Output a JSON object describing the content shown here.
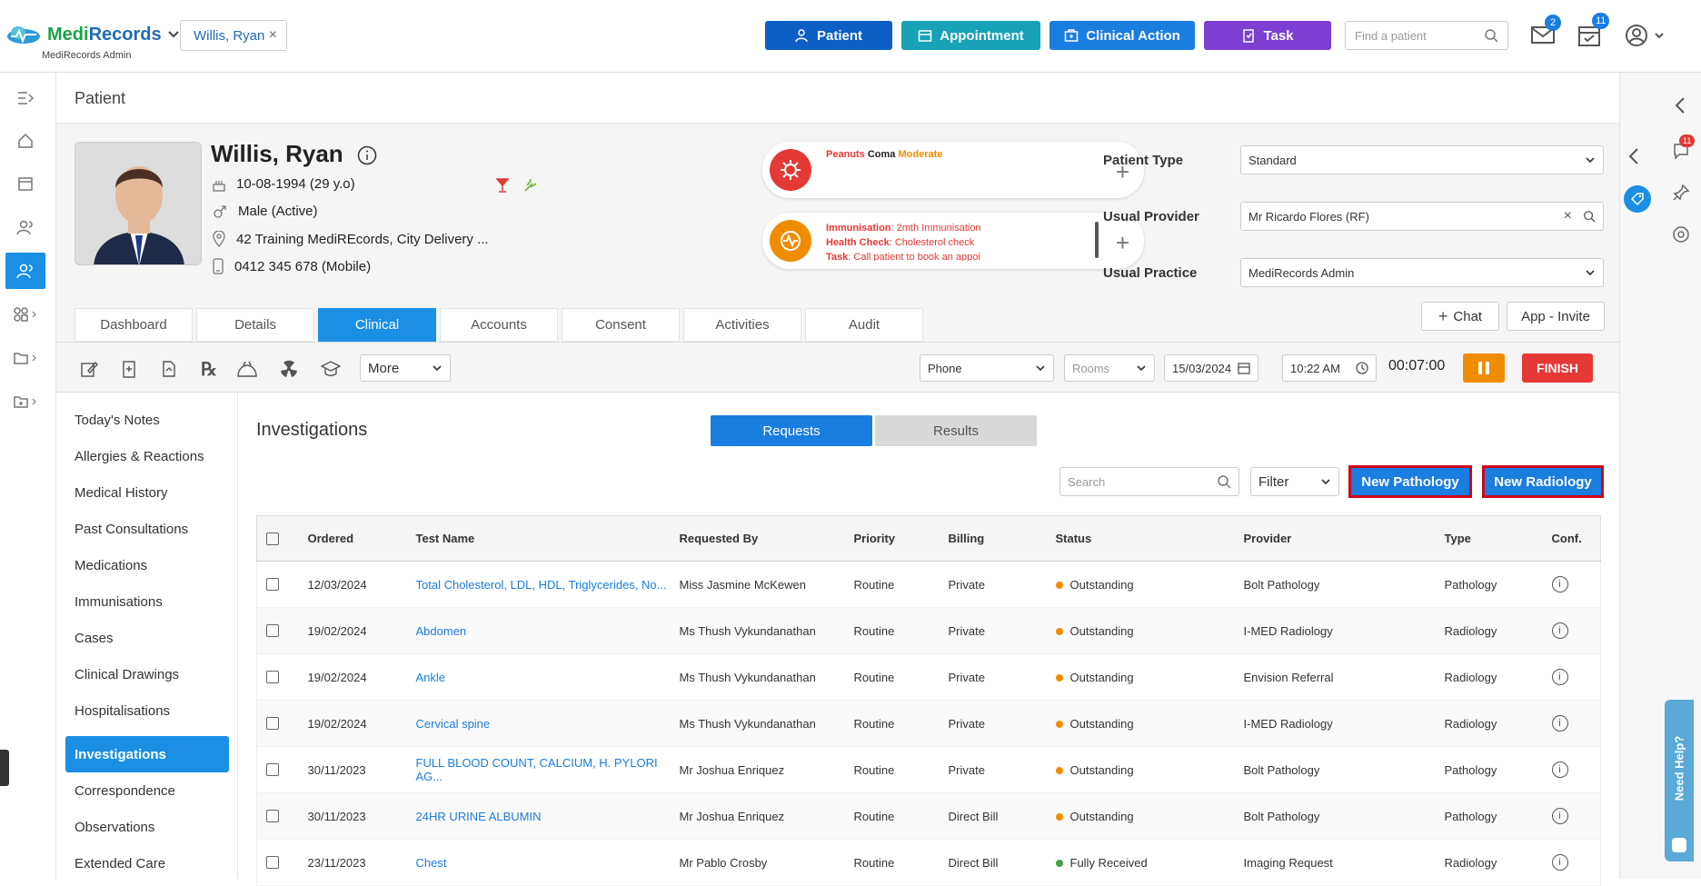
{
  "app": {
    "brand_part1": "Medi",
    "brand_part2": "Records",
    "subtitle": "MediRecords Admin",
    "patient_tag": "Willis, Ryan"
  },
  "topbar": {
    "buttons": [
      {
        "label": "Patient",
        "color": "#0b5fc5"
      },
      {
        "label": "Appointment",
        "color": "#17a2b8"
      },
      {
        "label": "Clinical Action",
        "color": "#1a7de0"
      },
      {
        "label": "Task",
        "color": "#7c3fd1"
      }
    ],
    "search_placeholder": "Find a patient",
    "mail_count": "2",
    "tasks_count": "11"
  },
  "page_title": "Patient",
  "patient": {
    "name": "Willis, Ryan",
    "dob": "10-08-1994 (29 y.o)",
    "gender": "Male (Active)",
    "address": "42 Training MediREcords, City Delivery ...",
    "phone": "0412 345 678 (Mobile)"
  },
  "allergy_card": {
    "allergen": "Peanuts",
    "reaction": "Coma",
    "severity": "Moderate"
  },
  "reminders_card": {
    "lines": [
      {
        "label": "Immunisation",
        "text": ": 2mth Immunisation"
      },
      {
        "label": "Health Check",
        "text": ": Cholesterol check"
      },
      {
        "label": "Task",
        "text": ": Call patient to book an appoi"
      }
    ]
  },
  "fields": {
    "patient_type_label": "Patient Type",
    "patient_type_value": "Standard",
    "usual_provider_label": "Usual Provider",
    "usual_provider_value": "Mr Ricardo Flores (RF)",
    "usual_practice_label": "Usual Practice",
    "usual_practice_value": "MediRecords Admin"
  },
  "tabs": [
    "Dashboard",
    "Details",
    "Clinical",
    "Accounts",
    "Consent",
    "Activities",
    "Audit"
  ],
  "chat_label": "Chat",
  "app_invite_label": "App - Invite",
  "toolbar": {
    "more_label": "More",
    "phone_value": "Phone",
    "rooms_placeholder": "Rooms",
    "date_value": "15/03/2024",
    "time_value": "10:22 AM",
    "timer": "00:07:00",
    "finish_label": "FINISH"
  },
  "sidenav": [
    "Today's Notes",
    "Allergies & Reactions",
    "Medical History",
    "Past Consultations",
    "Medications",
    "Immunisations",
    "Cases",
    "Clinical Drawings",
    "Hospitalisations",
    "Investigations",
    "Correspondence",
    "Observations",
    "Extended Care"
  ],
  "investigations": {
    "title": "Investigations",
    "requests_label": "Requests",
    "results_label": "Results",
    "search_placeholder": "Search",
    "filter_label": "Filter",
    "new_pathology_label": "New Pathology",
    "new_radiology_label": "New Radiology",
    "columns": [
      "Ordered",
      "Test Name",
      "Requested By",
      "Priority",
      "Billing",
      "Status",
      "Provider",
      "Type",
      "Conf."
    ],
    "rows": [
      {
        "ordered": "12/03/2024",
        "test": "Total Cholesterol, LDL, HDL, Triglycerides, No...",
        "by": "Miss Jasmine McKewen",
        "priority": "Routine",
        "billing": "Private",
        "status": "Outstanding",
        "status_color": "#f08c00",
        "provider": "Bolt Pathology",
        "type": "Pathology"
      },
      {
        "ordered": "19/02/2024",
        "test": "Abdomen",
        "by": "Ms Thush Vykundanathan",
        "priority": "Routine",
        "billing": "Private",
        "status": "Outstanding",
        "status_color": "#f08c00",
        "provider": "I-MED Radiology",
        "type": "Radiology"
      },
      {
        "ordered": "19/02/2024",
        "test": "Ankle",
        "by": "Ms Thush Vykundanathan",
        "priority": "Routine",
        "billing": "Private",
        "status": "Outstanding",
        "status_color": "#f08c00",
        "provider": "Envision Referral",
        "type": "Radiology"
      },
      {
        "ordered": "19/02/2024",
        "test": "Cervical spine",
        "by": "Ms Thush Vykundanathan",
        "priority": "Routine",
        "billing": "Private",
        "status": "Outstanding",
        "status_color": "#f08c00",
        "provider": "I-MED Radiology",
        "type": "Radiology"
      },
      {
        "ordered": "30/11/2023",
        "test": "FULL BLOOD COUNT, CALCIUM, H. PYLORI AG...",
        "by": "Mr Joshua Enriquez",
        "priority": "Routine",
        "billing": "Private",
        "status": "Outstanding",
        "status_color": "#f08c00",
        "provider": "Bolt Pathology",
        "type": "Pathology"
      },
      {
        "ordered": "30/11/2023",
        "test": "24HR URINE ALBUMIN",
        "by": "Mr Joshua Enriquez",
        "priority": "Routine",
        "billing": "Direct Bill",
        "status": "Outstanding",
        "status_color": "#f08c00",
        "provider": "Bolt Pathology",
        "type": "Pathology"
      },
      {
        "ordered": "23/11/2023",
        "test": "Chest",
        "by": "Mr Pablo Crosby",
        "priority": "Routine",
        "billing": "Direct Bill",
        "status": "Fully Received",
        "status_color": "#43a047",
        "provider": "Imaging Request",
        "type": "Radiology"
      }
    ]
  },
  "need_help_label": "Need Help?",
  "right_rail": {
    "chat_count": "11"
  }
}
